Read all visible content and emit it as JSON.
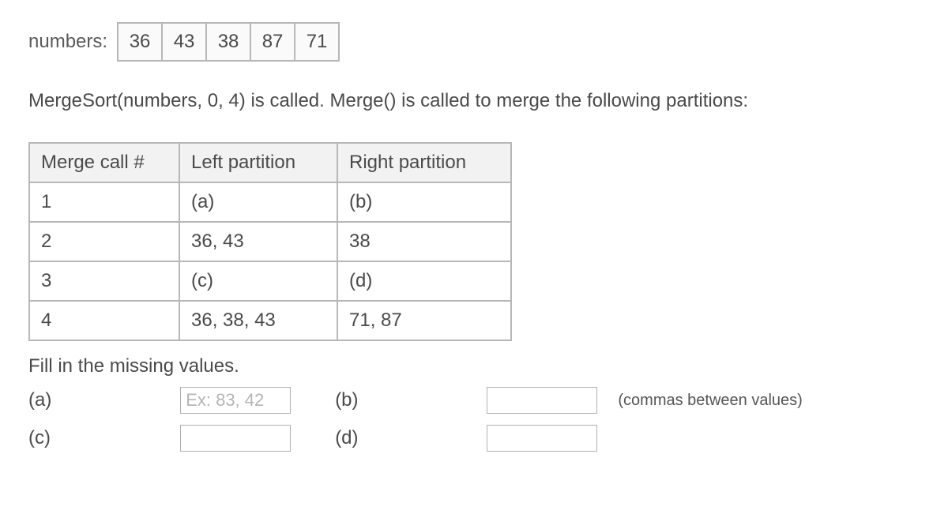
{
  "numbers": {
    "label": "numbers:",
    "cells": [
      "36",
      "43",
      "38",
      "87",
      "71"
    ]
  },
  "paragraph": "MergeSort(numbers, 0, 4) is called. Merge() is called to merge the following partitions:",
  "mergeTable": {
    "headers": [
      "Merge call #",
      "Left partition",
      "Right partition"
    ],
    "rows": [
      {
        "call": "1",
        "left": "(a)",
        "right": "(b)"
      },
      {
        "call": "2",
        "left": "36, 43",
        "right": "38"
      },
      {
        "call": "3",
        "left": "(c)",
        "right": "(d)"
      },
      {
        "call": "4",
        "left": "36, 38, 43",
        "right": "71, 87"
      }
    ]
  },
  "fill": {
    "prompt": "Fill in the missing values.",
    "labels": {
      "a": "(a)",
      "b": "(b)",
      "c": "(c)",
      "d": "(d)"
    },
    "placeholder_a": "Ex: 83, 42",
    "hint": "(commas between values)"
  }
}
